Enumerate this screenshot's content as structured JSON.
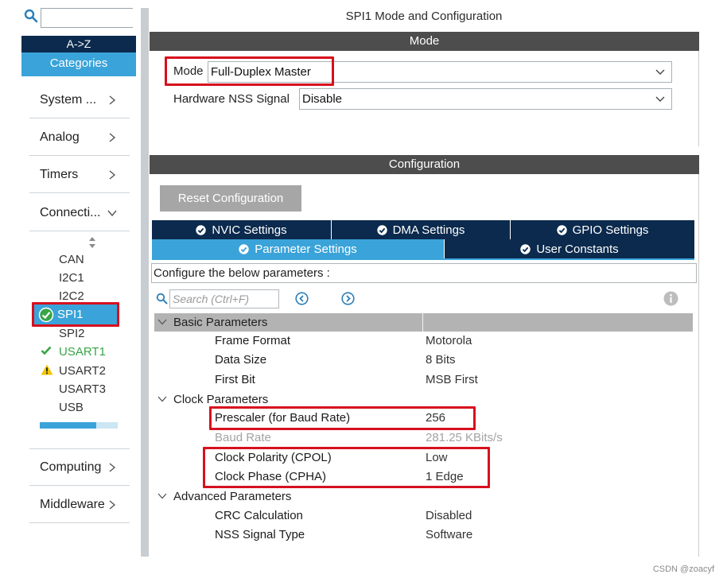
{
  "window": {
    "title": "SPI1 Mode and Configuration"
  },
  "sidebar": {
    "search": {
      "value": "",
      "placeholder": ""
    },
    "sort_az": "A->Z",
    "categories": "Categories",
    "categories_items": [
      "System ...",
      "Analog",
      "Timers",
      "Connecti..."
    ],
    "bottom_items": [
      "Computing",
      "Middleware"
    ],
    "peripherals": [
      "CAN",
      "I2C1",
      "I2C2",
      "SPI1",
      "SPI2",
      "USART1",
      "USART2",
      "USART3",
      "USB"
    ],
    "progress": 0.72
  },
  "mode": {
    "section_title": "Mode",
    "mode_label": "Mode",
    "mode_value": "Full-Duplex Master",
    "nss_label": "Hardware NSS Signal",
    "nss_value": "Disable"
  },
  "config": {
    "section_title": "Configuration",
    "reset_button": "Reset Configuration",
    "tabs_row1": [
      "NVIC Settings",
      "DMA Settings",
      "GPIO Settings"
    ],
    "tabs_row2": [
      "Parameter Settings",
      "User Constants"
    ],
    "description": "Configure the below parameters :",
    "search_placeholder": "Search (Ctrl+F)",
    "groups": [
      {
        "name": "Basic Parameters",
        "params": [
          {
            "name": "Frame Format",
            "value": "Motorola"
          },
          {
            "name": "Data Size",
            "value": "8 Bits"
          },
          {
            "name": "First Bit",
            "value": "MSB First"
          }
        ]
      },
      {
        "name": "Clock Parameters",
        "params": [
          {
            "name": "Prescaler (for Baud Rate)",
            "value": "256"
          },
          {
            "name": "Baud Rate",
            "value": "281.25 KBits/s"
          },
          {
            "name": "Clock Polarity (CPOL)",
            "value": "Low"
          },
          {
            "name": "Clock Phase (CPHA)",
            "value": "1 Edge"
          }
        ]
      },
      {
        "name": "Advanced Parameters",
        "params": [
          {
            "name": "CRC Calculation",
            "value": "Disabled"
          },
          {
            "name": "NSS Signal Type",
            "value": "Software"
          }
        ]
      }
    ]
  },
  "watermark": "CSDN @zoacyf",
  "colors": {
    "navy": "#0b2a4d",
    "accent_blue": "#3aa3d9",
    "section_bar": "#4d4d4d",
    "highlight_red": "#d7101e",
    "ok_green": "#37a547",
    "warning_yellow": "#f2c500"
  }
}
